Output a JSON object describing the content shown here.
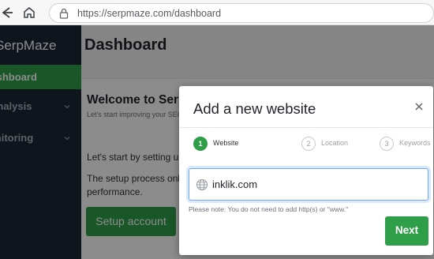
{
  "browser": {
    "url": "https://serpmaze.com/dashboard"
  },
  "sidebar": {
    "brand": "SerpMaze",
    "items": [
      {
        "label": "Dashboard",
        "active": true
      },
      {
        "label": "Analysis",
        "has_chevron": true
      },
      {
        "label": "Monitoring",
        "has_chevron": true
      }
    ]
  },
  "main": {
    "page_title": "Dashboard",
    "welcome_title": "Welcome to SerpMaze",
    "welcome_subtitle": "Let's start improving your SEO rankings",
    "body_line_1": "Let's start by setting up your account.",
    "body_line_2": "The setup process only takes a few minutes to see your",
    "body_line_3": "performance.",
    "setup_button": "Setup account"
  },
  "modal": {
    "title": "Add a new website",
    "steps": [
      {
        "number": "1",
        "label": "Website",
        "active": true
      },
      {
        "number": "2",
        "label": "Location",
        "active": false
      },
      {
        "number": "3",
        "label": "Keywords",
        "active": false
      }
    ],
    "input_value": "inklik.com",
    "note": "Please note: You do not need to add http(s) or \"www.\"",
    "next_button": "Next"
  },
  "colors": {
    "accent_green": "#2e9e49",
    "sidebar_bg": "#1b2735",
    "focus_blue": "#6ea8f5"
  }
}
